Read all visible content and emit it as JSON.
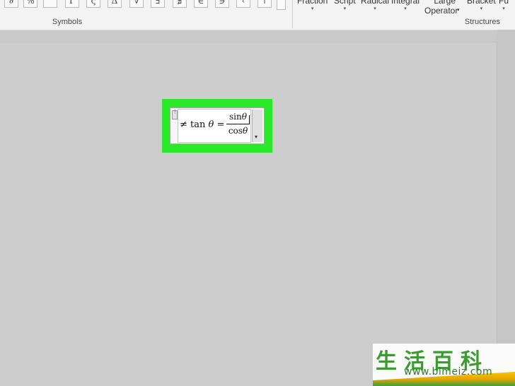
{
  "ribbon": {
    "symbols": {
      "group_label": "Symbols",
      "buttons": [
        "∂",
        "%",
        "°",
        "Γ",
        "ς",
        "Δ",
        "∇",
        "∃",
        "∄",
        "∈",
        "∋",
        "‹",
        "↑"
      ],
      "scroll_glyph": "▾"
    },
    "structures": {
      "group_label": "Structures",
      "items": [
        {
          "label": "Fraction",
          "arrow": "▾"
        },
        {
          "label": "Script",
          "arrow": "▾"
        },
        {
          "label": "Radical",
          "arrow": "▾"
        },
        {
          "label": "Integral",
          "arrow": "▾"
        },
        {
          "label": "Large",
          "label2": "Operator",
          "arrow": "▾"
        },
        {
          "label": "Bracket",
          "arrow": "▾"
        },
        {
          "label": "Fu",
          "arrow": "▾"
        }
      ]
    }
  },
  "equation": {
    "lhs_symbol": "≠",
    "lhs_func": "tan",
    "lhs_var": "θ",
    "equals": "=",
    "numerator_func": "sin",
    "numerator_var": "θ",
    "denominator_func": "cos",
    "denominator_var": "θ",
    "handle_glyph": "⋮",
    "dropdown_glyph": "▾",
    "highlight_color": "#2ae82a"
  },
  "watermark": {
    "chinese": "生活百科",
    "url": "www.bimeiz.com"
  }
}
